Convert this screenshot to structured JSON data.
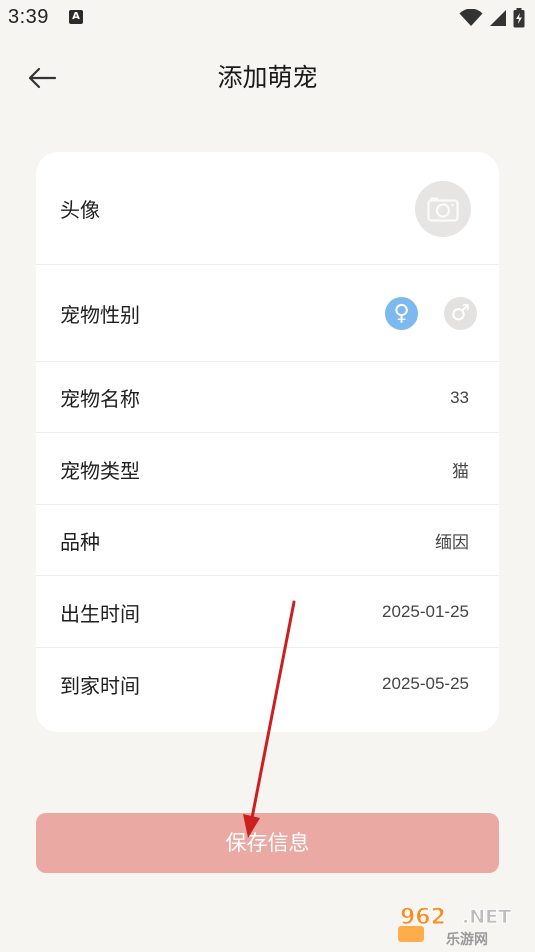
{
  "status_bar": {
    "time": "3:39",
    "notification_icon": "A",
    "icons": [
      "wifi-icon",
      "signal-icon",
      "battery-icon"
    ]
  },
  "header": {
    "back_icon": "arrow-left-icon",
    "title": "添加萌宠"
  },
  "form": {
    "avatar": {
      "label": "头像",
      "icon": "camera-icon"
    },
    "gender": {
      "label": "宠物性别",
      "options": [
        {
          "symbol": "♀",
          "selected": true,
          "color": "#7db9ee"
        },
        {
          "symbol": "♂",
          "selected": false,
          "color": "#e3e2e0"
        }
      ]
    },
    "name": {
      "label": "宠物名称",
      "value": "33"
    },
    "type": {
      "label": "宠物类型",
      "value": "猫"
    },
    "breed": {
      "label": "品种",
      "value": "缅因"
    },
    "birth_date": {
      "label": "出生时间",
      "value": "2025-01-25"
    },
    "home_date": {
      "label": "到家时间",
      "value": "2025-05-25"
    }
  },
  "save_button": {
    "label": "保存信息",
    "color": "#eaa9a2"
  },
  "watermark": {
    "brand": "962.NET",
    "subtitle": "乐游网"
  },
  "colors": {
    "background": "#f7f5f2",
    "card": "#ffffff",
    "annotation_arrow": "#cc1f1f"
  }
}
